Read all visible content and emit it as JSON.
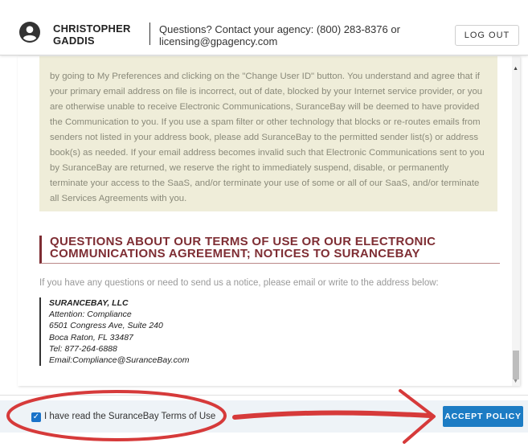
{
  "header": {
    "user_name_line1": "CHRISTOPHER",
    "user_name_line2": "GADDIS",
    "contact_line1": "Questions? Contact your agency: (800) 283-8376 or",
    "contact_line2": "licensing@gpagency.com",
    "logout_label": "LOG OUT"
  },
  "body": {
    "paragraph": "by going to My Preferences and clicking on the \"Change User ID\" button. You understand and agree that if your primary email address on file is incorrect, out of date, blocked by your Internet service provider, or you are otherwise unable to receive Electronic Communications, SuranceBay will be deemed to have provided the Communication to you. If you use a spam filter or other technology that blocks or re-routes emails from senders not listed in your address book, please add SuranceBay to the permitted sender list(s) or address book(s) as needed. If your email address becomes invalid such that Electronic Communications sent to you by SuranceBay are returned, we reserve the right to immediately suspend, disable, or permanently terminate your access to the SaaS, and/or terminate your use of some or all of our SaaS, and/or terminate all Services Agreements with you.",
    "section_heading_line1": "QUESTIONS ABOUT OUR TERMS OF USE OR OUR ELECTRONIC",
    "section_heading_line2": "COMMUNICATIONS AGREEMENT; NOTICES TO SURANCEBAY",
    "intro": "If you have any questions or need to send us a notice, please email or write to the address below:",
    "address": {
      "firm": "SURANCEBAY, LLC",
      "attention": "Attention: Compliance",
      "street": "6501 Congress Ave, Suite 240",
      "city": "Boca Raton, FL 33487",
      "tel": "Tel: 877-264-6888",
      "email": "Email:Compliance@SuranceBay.com"
    }
  },
  "footer": {
    "agree_label": "I have read the SuranceBay Terms of Use",
    "agree_checked": true,
    "accept_label": "ACCEPT POLICY"
  },
  "colors": {
    "accent": "#1c7cc4",
    "heading": "#7e2d33",
    "annotation": "#d63a3a"
  },
  "icons": [
    "account-circle-icon",
    "checkbox-checked-icon",
    "scroll-up-icon",
    "scroll-down-icon"
  ]
}
